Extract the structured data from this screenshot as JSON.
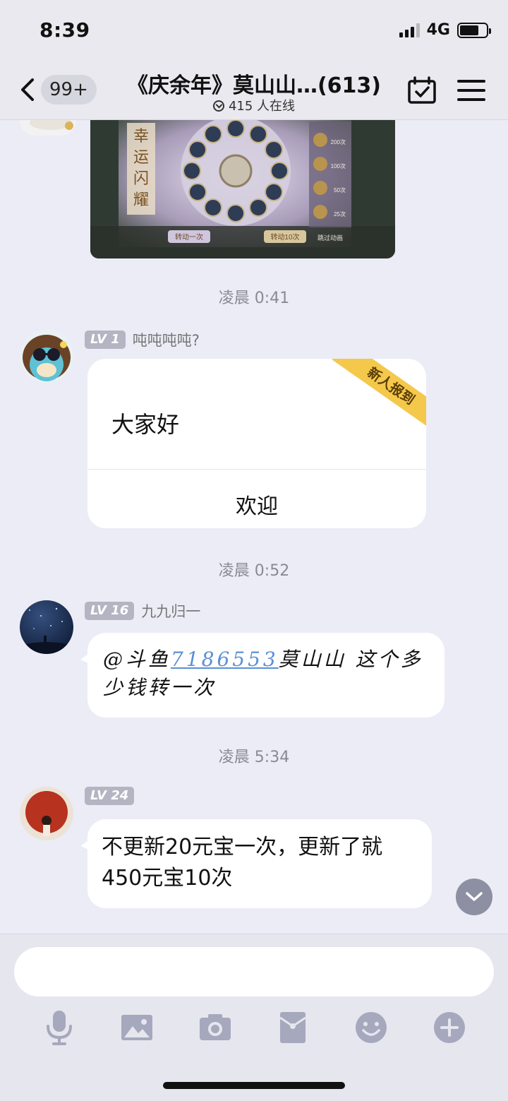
{
  "status": {
    "time": "8:39",
    "network": "4G"
  },
  "header": {
    "back_badge": "99+",
    "title": "《庆余年》莫山山…(613)",
    "online": "415 人在线"
  },
  "messages": [
    {
      "timestamp": "凌晨 0:41",
      "level": "LV 1",
      "nickname": "吨吨吨吨?",
      "card_text": "大家好",
      "card_action": "欢迎",
      "ribbon": "新人报到"
    },
    {
      "timestamp": "凌晨 0:52",
      "level": "LV 16",
      "nickname": "九九归一",
      "text_prefix": "@斗鱼",
      "mention_link": "7186553",
      "text_suffix": "莫山山 这个多少钱转一次"
    },
    {
      "timestamp": "凌晨 5:34",
      "level": "LV 24",
      "nickname": "",
      "text": "不更新20元宝一次，更新了就450元宝10次"
    }
  ],
  "game_image": {
    "title_vertical": "幸运闪耀",
    "btn_once": "转动一次",
    "btn_ten": "转动10次",
    "skip": "跳过动画",
    "prize_labels": [
      "200次",
      "100次",
      "50次",
      "25次"
    ]
  },
  "input": {
    "value": "",
    "placeholder": ""
  },
  "toolbar": {
    "icons": [
      "mic-icon",
      "image-icon",
      "camera-icon",
      "red-packet-icon",
      "emoji-icon",
      "plus-icon"
    ]
  },
  "colors": {
    "background": "#ececf6",
    "bubble": "#ffffff",
    "level_badge": "#b4b4c2",
    "ribbon": "#f4c84a",
    "link": "#5b8fd6",
    "tool_icon": "#a6a8bd"
  }
}
